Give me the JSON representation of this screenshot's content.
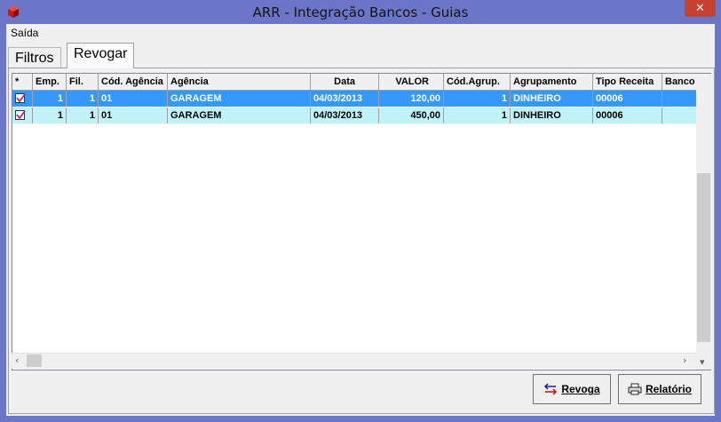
{
  "window": {
    "title": "ARR -  Integração Bancos - Guias",
    "close_label": "✕",
    "app_icon": "app-cube-icon"
  },
  "menu": {
    "items": [
      {
        "label": "Saída"
      }
    ]
  },
  "tabs": [
    {
      "label": "Filtros",
      "active": false
    },
    {
      "label": "Revogar",
      "active": true
    }
  ],
  "grid": {
    "columns": [
      "*",
      "Emp.",
      "Fil.",
      "Cód. Agência",
      "Agência",
      "Data",
      "VALOR",
      "Cód.Agrup.",
      "Agrupamento",
      "Tipo Receita",
      "Banco"
    ],
    "rows": [
      {
        "checked": true,
        "emp": "1",
        "fil": "1",
        "cod_agencia": "01",
        "agencia": "GARAGEM",
        "data": "04/03/2013",
        "valor": "120,00",
        "cod_agrup": "1",
        "agrupamento": "DINHEIRO",
        "tipo_receita": "00006",
        "banco": ""
      },
      {
        "checked": true,
        "emp": "1",
        "fil": "1",
        "cod_agencia": "01",
        "agencia": "GARAGEM",
        "data": "04/03/2013",
        "valor": "450,00",
        "cod_agrup": "1",
        "agrupamento": "DINHEIRO",
        "tipo_receita": "00006",
        "banco": ""
      }
    ],
    "selected_row_color": "#3399ff",
    "alt_row_color": "#bff3f7"
  },
  "buttons": {
    "revoga_label": "Revoga",
    "relatorio_label": "Relatório"
  },
  "colors": {
    "titlebar": "#6b76c8",
    "close": "#c8412f"
  }
}
